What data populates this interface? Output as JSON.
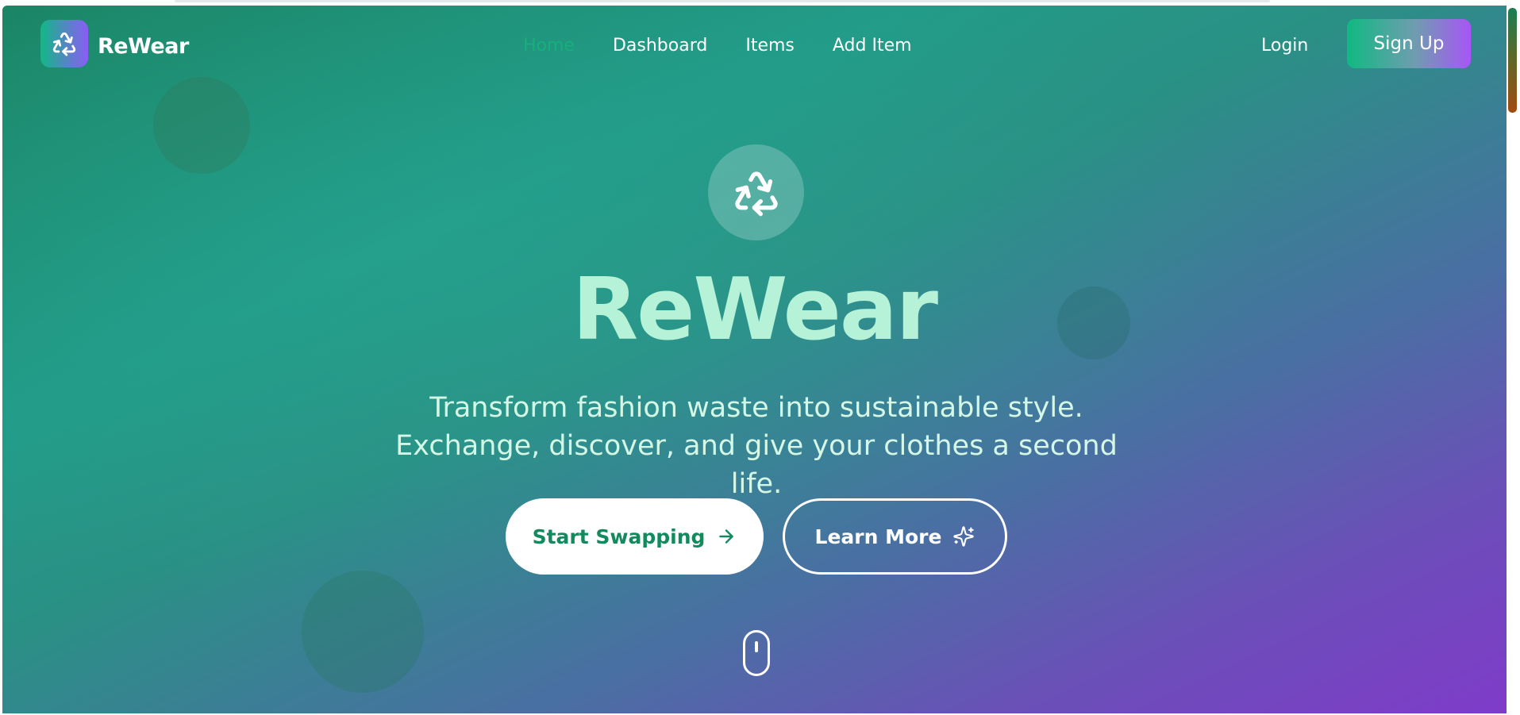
{
  "brand": {
    "name": "ReWear",
    "logo_icon": "recycle-icon"
  },
  "nav": {
    "links": [
      {
        "label": "Home",
        "active": true
      },
      {
        "label": "Dashboard",
        "active": false
      },
      {
        "label": "Items",
        "active": false
      },
      {
        "label": "Add Item",
        "active": false
      }
    ],
    "login_label": "Login",
    "signup_label": "Sign Up"
  },
  "hero": {
    "icon": "recycle-icon",
    "title": "ReWear",
    "subtitle": "Transform fashion waste into sustainable style. Exchange, discover, and give your clothes a second life.",
    "primary_cta": {
      "label": "Start Swapping",
      "icon": "arrow-right-icon"
    },
    "secondary_cta": {
      "label": "Learn More",
      "icon": "sparkles-icon"
    },
    "scroll_indicator_icon": "mouse-scroll-icon"
  },
  "colors": {
    "accent_green": "#10b981",
    "accent_purple": "#a855f7",
    "active_nav": "#18b07a",
    "title_mint": "#b5f2d8"
  }
}
